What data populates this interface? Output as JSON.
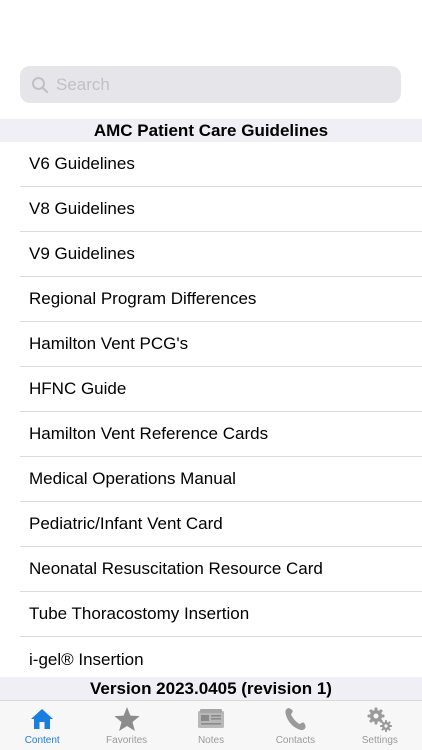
{
  "search": {
    "placeholder": "Search",
    "value": ""
  },
  "section": {
    "title": "AMC Patient Care Guidelines"
  },
  "list": {
    "items": [
      "V6 Guidelines",
      "V8 Guidelines",
      "V9 Guidelines",
      "Regional Program Differences",
      "Hamilton Vent PCG's",
      "HFNC Guide",
      "Hamilton Vent Reference Cards",
      "Medical Operations Manual",
      "Pediatric/Infant Vent Card",
      "Neonatal Resuscitation Resource Card",
      "Tube Thoracostomy Insertion",
      "i-gel® Insertion"
    ]
  },
  "footer": {
    "version": "Version 2023.0405 (revision 1)"
  },
  "tabs": [
    {
      "label": "Content",
      "icon": "home-icon",
      "active": true
    },
    {
      "label": "Favorites",
      "icon": "star-icon",
      "active": false
    },
    {
      "label": "Notes",
      "icon": "notes-icon",
      "active": false
    },
    {
      "label": "Contacts",
      "icon": "phone-icon",
      "active": false
    },
    {
      "label": "Settings",
      "icon": "gear-icon",
      "active": false
    }
  ],
  "colors": {
    "accent": "#1a7de0",
    "inactive": "#9a9a9a",
    "header_bg": "#efeff5",
    "search_bg": "#e6e6ea"
  }
}
